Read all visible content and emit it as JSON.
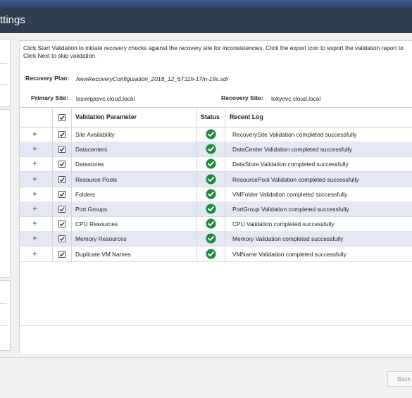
{
  "window": {
    "title": "ttings"
  },
  "info": {
    "text": "Click Start Validation to initiate recovery checks against the recovery site for inconsistencies. Click the export icon to export the validation report to Click Next to skip validation."
  },
  "recovery_plan": {
    "label": "Recovery Plan:",
    "value": "NewRecoveryConfiguration_2018_12_6T11h-17m-19s.sdr"
  },
  "primary_site": {
    "label": "Primary Site:",
    "value": "lasvegasvc.cloud.local"
  },
  "recovery_site": {
    "label": "Recovery Site:",
    "value": "tokyovc.cloud.local"
  },
  "table": {
    "columns": [
      "Validation Parameter",
      "Status",
      "Recent Log"
    ],
    "rows": [
      {
        "parameter": "Site Availability",
        "log": "RecoverySite Validation completed successfully",
        "status": "success",
        "checked": true
      },
      {
        "parameter": "Datacenters",
        "log": "DataCenter Validation completed successfully",
        "status": "success",
        "checked": true
      },
      {
        "parameter": "Datastores",
        "log": "DataStore Validation completed successfully",
        "status": "success",
        "checked": true
      },
      {
        "parameter": "Resource Pools",
        "log": "ResourcePool Validation completed successfully",
        "status": "success",
        "checked": true
      },
      {
        "parameter": "Folders",
        "log": "VMFolder Validation completed successfully",
        "status": "success",
        "checked": true
      },
      {
        "parameter": "Port Groups",
        "log": "PortGroup Validation completed successfully",
        "status": "success",
        "checked": true
      },
      {
        "parameter": "CPU Resources",
        "log": "CPU Validation completed successfully",
        "status": "success",
        "checked": true
      },
      {
        "parameter": "Memory Resources",
        "log": "Memory Validation completed successfully",
        "status": "success",
        "checked": true
      },
      {
        "parameter": "Duplicate VM Names",
        "log": "VMName Validation completed successfully",
        "status": "success",
        "checked": true
      }
    ],
    "expand_glyph": "+"
  },
  "footer": {
    "back_label": "Back"
  },
  "colors": {
    "titlebar": "#2e3f52",
    "row_alt": "#e3e8f4",
    "success": "#1e8a3c"
  }
}
